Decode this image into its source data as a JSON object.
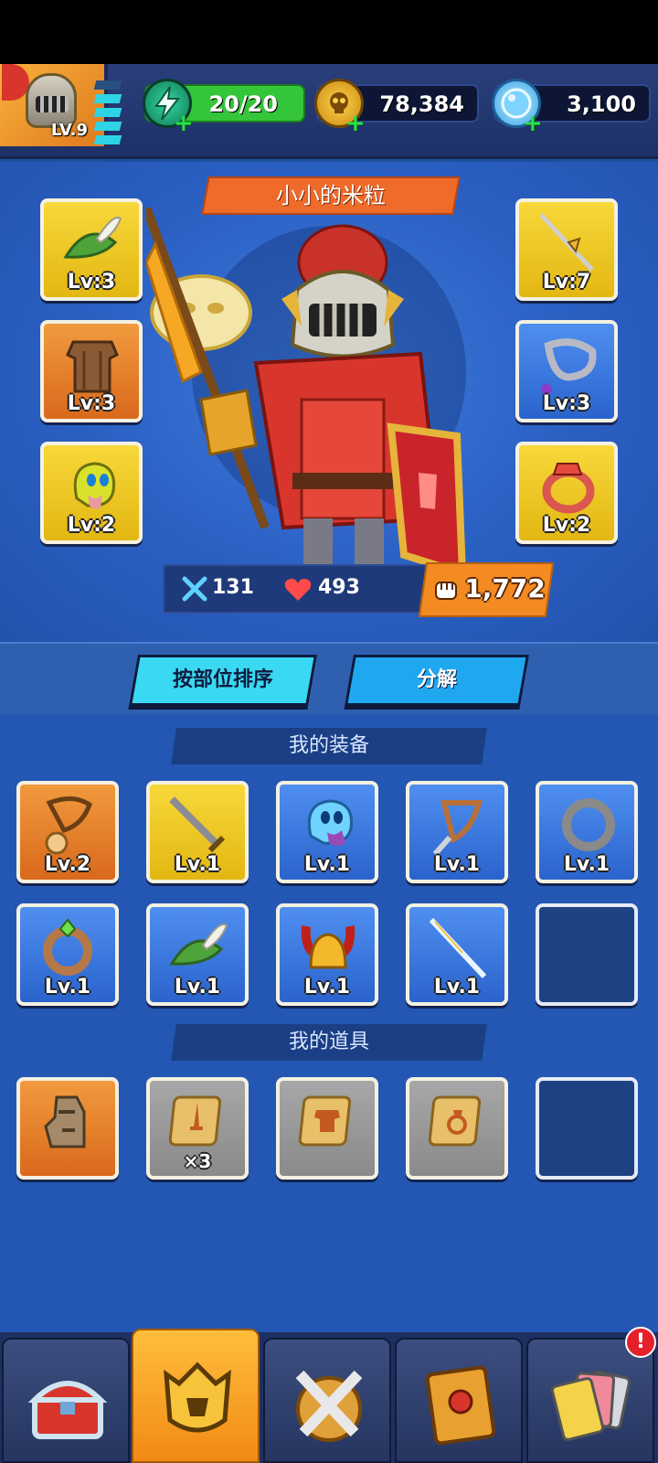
{
  "player": {
    "level_label": "LV.9"
  },
  "resources": {
    "energy": {
      "value": "20/20",
      "icon": "lightning-icon"
    },
    "gold": {
      "value": "78,384",
      "icon": "skull-coin-icon"
    },
    "gems": {
      "value": "3,100",
      "icon": "gem-icon"
    }
  },
  "hero": {
    "name": "小小的米粒",
    "left_slots": [
      {
        "item": "green-feather-hat",
        "level": "Lv:3"
      },
      {
        "item": "wooden-chest-armor",
        "level": "Lv:3"
      },
      {
        "item": "yellow-ghost-pet",
        "level": "Lv:2"
      }
    ],
    "right_slots": [
      {
        "item": "golden-spear",
        "level": "Lv:7"
      },
      {
        "item": "chain-necklace",
        "level": "Lv:3"
      },
      {
        "item": "ruby-ring",
        "level": "Lv:2"
      }
    ],
    "stats": {
      "attack": "131",
      "health": "493",
      "power": "1,772"
    }
  },
  "actions": {
    "sort_label": "按部位排序",
    "decompose_label": "分解"
  },
  "equipment": {
    "title": "我的装备",
    "items": [
      {
        "item": "gold-pendant-necklace",
        "level": "Lv.2",
        "color": "orange"
      },
      {
        "item": "steel-sword",
        "level": "Lv.1",
        "color": "yellow"
      },
      {
        "item": "blue-ghost-pet",
        "level": "Lv.1",
        "color": "blue"
      },
      {
        "item": "rope-necklace",
        "level": "Lv.1",
        "color": "blue"
      },
      {
        "item": "stone-ring",
        "level": "Lv.1",
        "color": "blue"
      },
      {
        "item": "gem-bracelet",
        "level": "Lv.1",
        "color": "blue"
      },
      {
        "item": "green-feather-hat",
        "level": "Lv.1",
        "color": "blue"
      },
      {
        "item": "horned-helmet",
        "level": "Lv.1",
        "color": "blue"
      },
      {
        "item": "crystal-spear",
        "level": "Lv.1",
        "color": "blue"
      },
      {
        "item": "empty",
        "level": "",
        "color": "empty"
      }
    ]
  },
  "props": {
    "title": "我的道具",
    "items": [
      {
        "item": "stone-head-statue",
        "qty": "",
        "color": "orange"
      },
      {
        "item": "weapon-scroll",
        "qty": "×3",
        "color": "gray"
      },
      {
        "item": "armor-scroll",
        "qty": "",
        "color": "gray"
      },
      {
        "item": "ring-scroll",
        "qty": "",
        "color": "gray"
      },
      {
        "item": "empty",
        "qty": "",
        "color": "empty"
      }
    ]
  },
  "nav": {
    "tabs": [
      "shop-chest",
      "hero-helmet",
      "battle-swords",
      "spell-book",
      "cards"
    ],
    "active": "hero-helmet",
    "alert": "!"
  },
  "colors": {
    "accent_orange": "#f38b22",
    "panel_blue": "#2a5fc2",
    "cyan_button": "#3ad8f2"
  }
}
